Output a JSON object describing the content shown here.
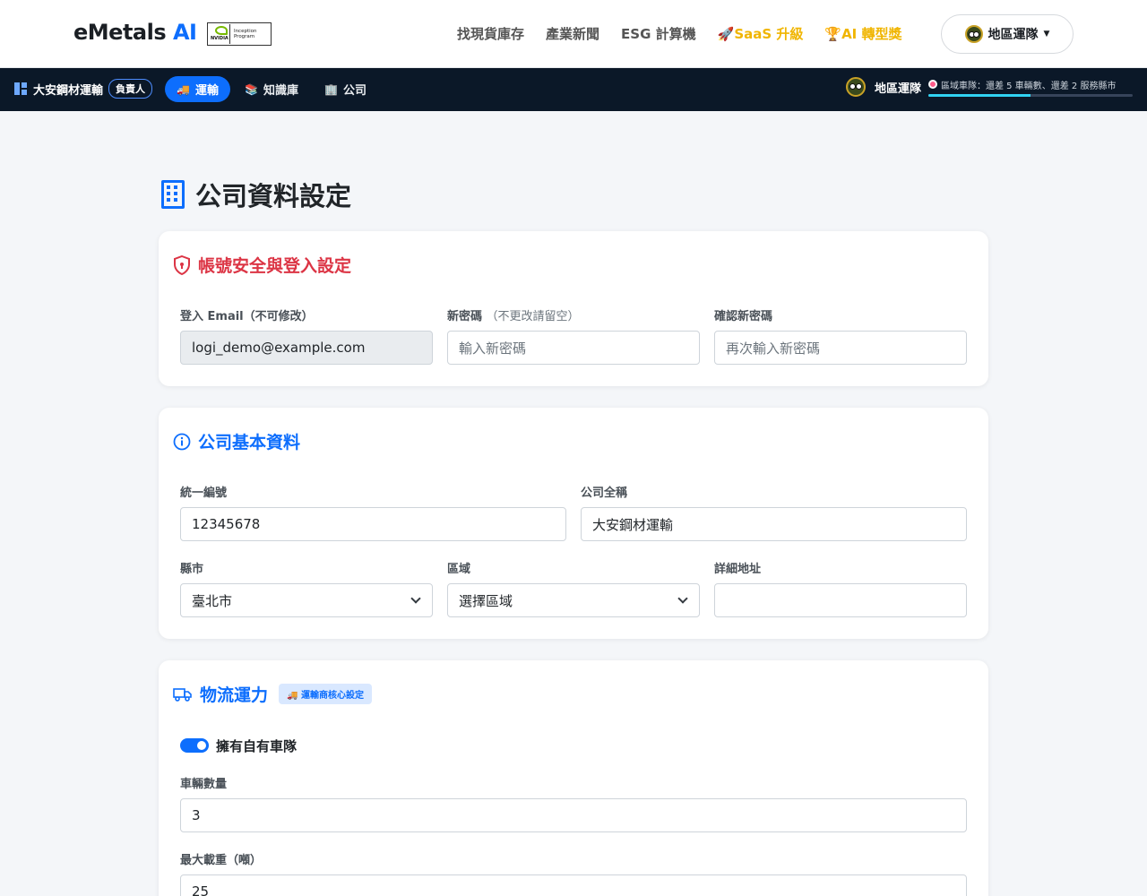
{
  "brand": {
    "name": "eMetals",
    "ai": "AI"
  },
  "nvidia_badge": {
    "logo_text": "NVIDIA",
    "program": "Inception Program"
  },
  "nav": {
    "links": [
      "找現貨庫存",
      "產業新聞",
      "ESG 計算機"
    ],
    "saas": "SaaS 升級",
    "award": "AI 轉型獎",
    "region_button": "地區運隊"
  },
  "subnav": {
    "company": "大安鋼材運輸",
    "role": "負責人",
    "tabs": [
      "運輸",
      "知識庫",
      "公司"
    ],
    "team": "地區運隊",
    "progress_text": "區域車隊：還差 5 車輛數、還差 2 服務縣市",
    "progress_value": 0.5
  },
  "page": {
    "title": "公司資料設定"
  },
  "security": {
    "title": "帳號安全與登入設定",
    "email_label": "登入 Email（不可修改）",
    "email_value": "logi_demo@example.com",
    "password_label": "新密碼",
    "password_hint": "（不更改請留空）",
    "password_placeholder": "輸入新密碼",
    "confirm_label": "確認新密碼",
    "confirm_placeholder": "再次輸入新密碼"
  },
  "basic": {
    "title": "公司基本資料",
    "tax_label": "統一編號",
    "tax_value": "12345678",
    "name_label": "公司全稱",
    "name_value": "大安鋼材運輸",
    "county_label": "縣市",
    "county_value": "臺北市",
    "district_label": "區域",
    "district_value": "選擇區域",
    "address_label": "詳細地址",
    "address_value": ""
  },
  "logistics": {
    "title": "物流運力",
    "chip": "運輸商核心設定",
    "own_fleet_label": "擁有自有車隊",
    "own_fleet": true,
    "vehicles_label": "車輛數量",
    "vehicles_value": "3",
    "max_load_label": "最大載重（噸）",
    "max_load_value": "25"
  },
  "colors": {
    "primary": "#0d6efd",
    "danger": "#dc3545",
    "gold": "#f0b500",
    "subnav_bg": "#0b1828"
  }
}
